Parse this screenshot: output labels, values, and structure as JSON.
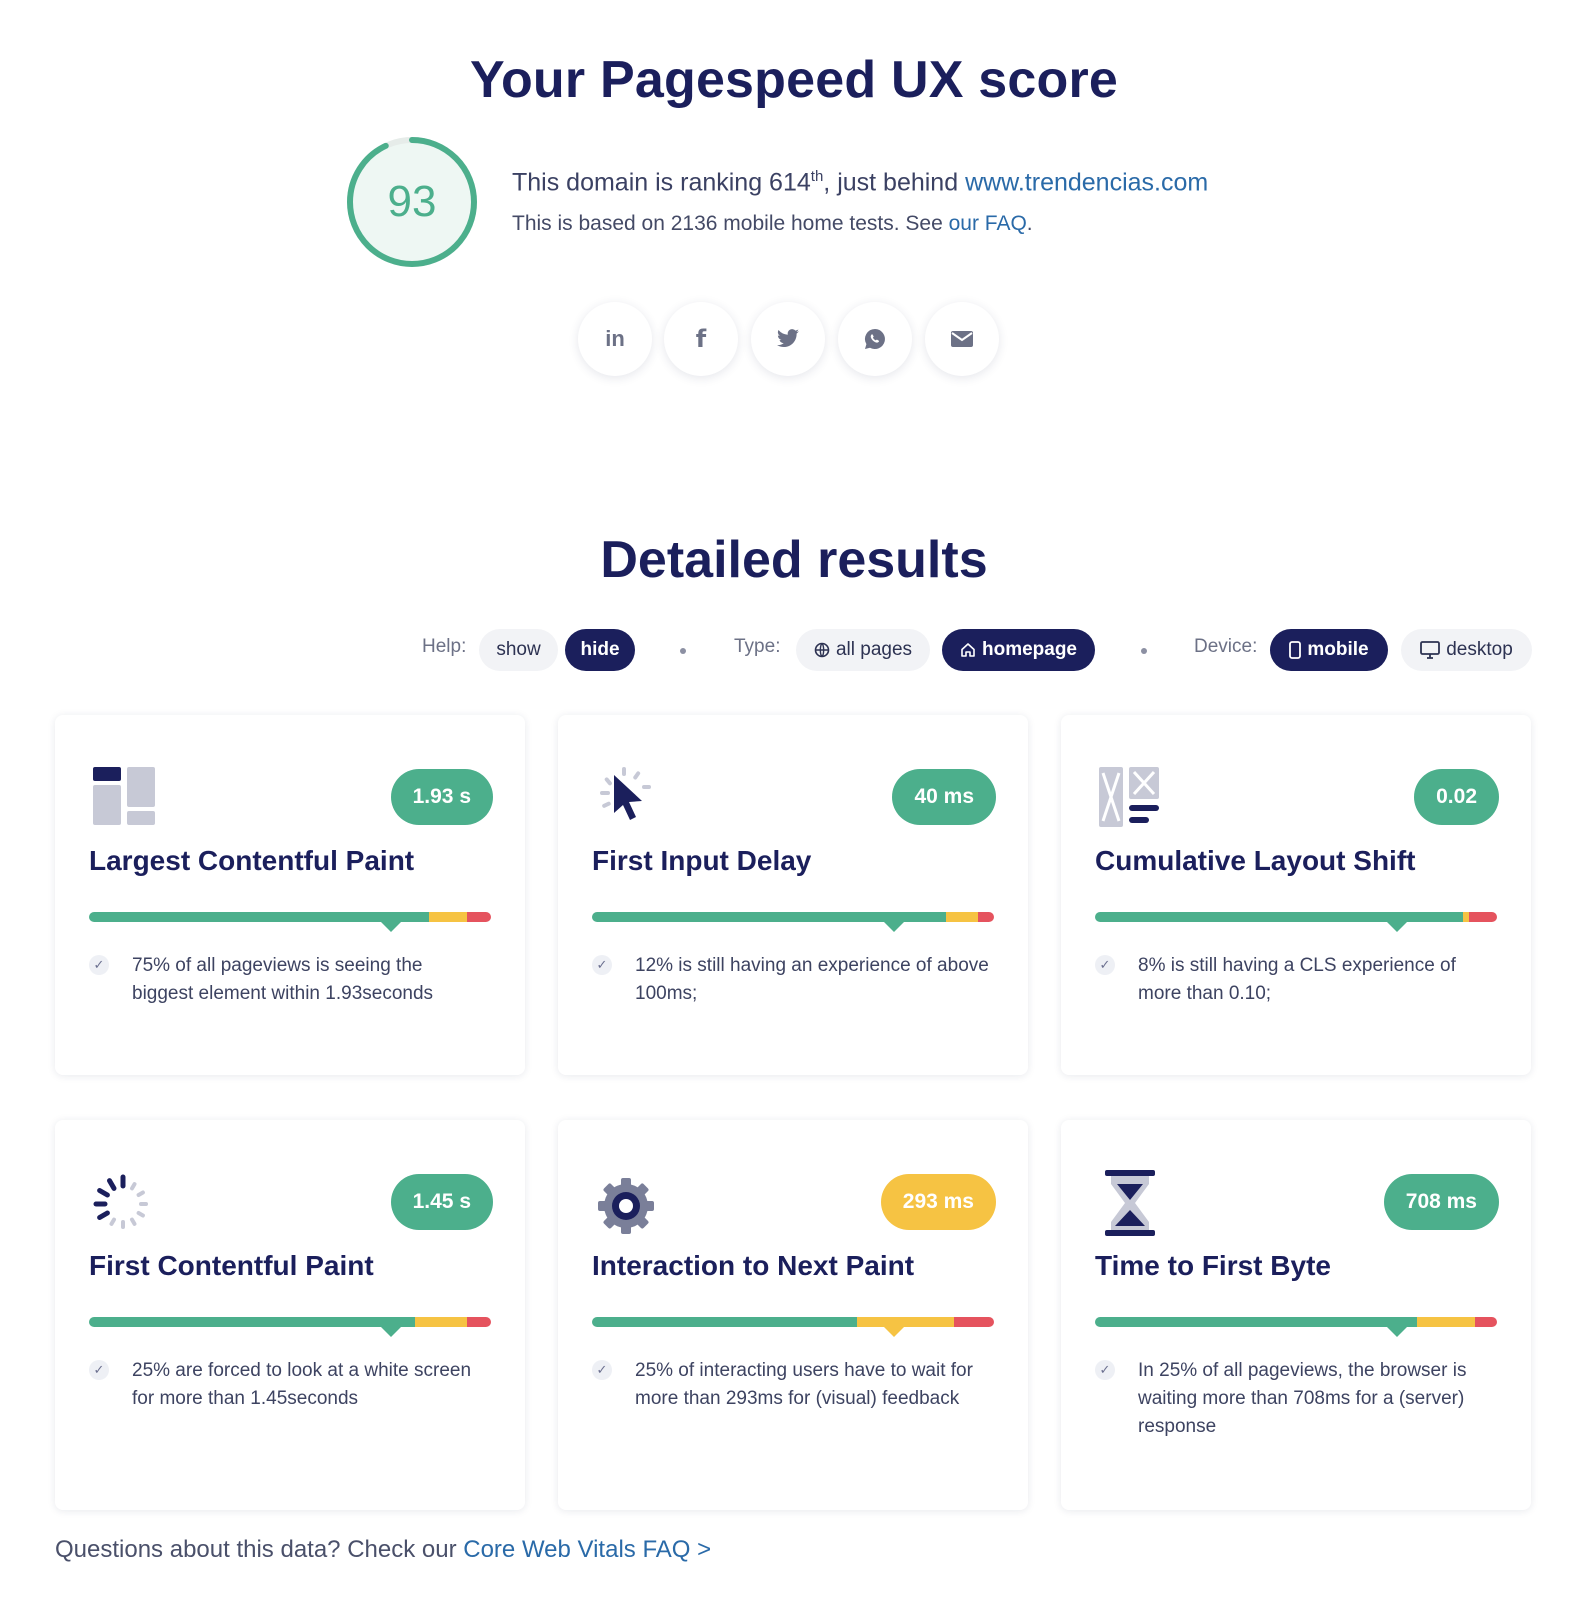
{
  "header": {
    "title": "Your Pagespeed UX score"
  },
  "score": {
    "value": "93",
    "fraction": 0.93,
    "color": "#4caf8c",
    "ranking_prefix": "This domain is ranking 614",
    "ranking_suffix": "th",
    "ranking_after": ", just behind ",
    "ranking_link": "www.trendencias.com",
    "based_text": "This is based on 2136 mobile home tests. See ",
    "based_link": "our FAQ",
    "based_end": "."
  },
  "share": [
    {
      "icon": "linkedin-icon",
      "glyph": "in"
    },
    {
      "icon": "facebook-icon",
      "glyph": "f"
    },
    {
      "icon": "twitter-icon",
      "glyph": ""
    },
    {
      "icon": "whatsapp-icon",
      "glyph": ""
    },
    {
      "icon": "email-icon",
      "glyph": ""
    }
  ],
  "details": {
    "title": "Detailed results"
  },
  "filters": {
    "help_label": "Help:",
    "help_show": "show",
    "help_hide": "hide",
    "type_label": "Type:",
    "type_all": "all pages",
    "type_home": "homepage",
    "device_label": "Device:",
    "device_mobile": "mobile",
    "device_desktop": "desktop",
    "active": {
      "help": "hide",
      "type": "homepage",
      "device": "mobile"
    }
  },
  "colors": {
    "good": "#4caf8c",
    "warn": "#f6c343",
    "bad": "#e5535e",
    "navy": "#1b1f5c"
  },
  "metrics": [
    {
      "name": "Largest Contentful Paint",
      "value": "1.93 s",
      "status": "good",
      "icon": "layout-blocks-icon",
      "desc": "75% of all pageviews is seeing the biggest element within 1.93seconds",
      "segments": [
        0.845,
        0.095,
        0.06
      ],
      "marker": 0.75
    },
    {
      "name": "First Input Delay",
      "value": "40 ms",
      "status": "good",
      "icon": "cursor-click-icon",
      "desc": "12% is still having an experience of above 100ms;",
      "segments": [
        0.88,
        0.08,
        0.04
      ],
      "marker": 0.75
    },
    {
      "name": "Cumulative Layout Shift",
      "value": "0.02",
      "status": "good",
      "icon": "layout-shift-icon",
      "desc": "8% is still having a CLS experience of more than 0.10;",
      "segments": [
        0.915,
        0.015,
        0.07
      ],
      "marker": 0.75
    },
    {
      "name": "First Contentful Paint",
      "value": "1.45 s",
      "status": "good",
      "icon": "spinner-icon",
      "desc": "25% are forced to look at a white screen for more than 1.45seconds",
      "segments": [
        0.81,
        0.13,
        0.06
      ],
      "marker": 0.75
    },
    {
      "name": "Interaction to Next Paint",
      "value": "293 ms",
      "status": "warn",
      "icon": "gear-icon",
      "desc": "25% of interacting users have to wait for more than 293ms for (visual) feedback",
      "segments": [
        0.66,
        0.24,
        0.1
      ],
      "marker": 0.75
    },
    {
      "name": "Time to First Byte",
      "value": "708 ms",
      "status": "good",
      "icon": "hourglass-icon",
      "desc": "In 25% of all pageviews, the browser is waiting more than 708ms for a (server) response",
      "segments": [
        0.8,
        0.145,
        0.055
      ],
      "marker": 0.75
    }
  ],
  "footer": {
    "question": "Questions about this data? Check our ",
    "link": "Core Web Vitals FAQ >"
  }
}
